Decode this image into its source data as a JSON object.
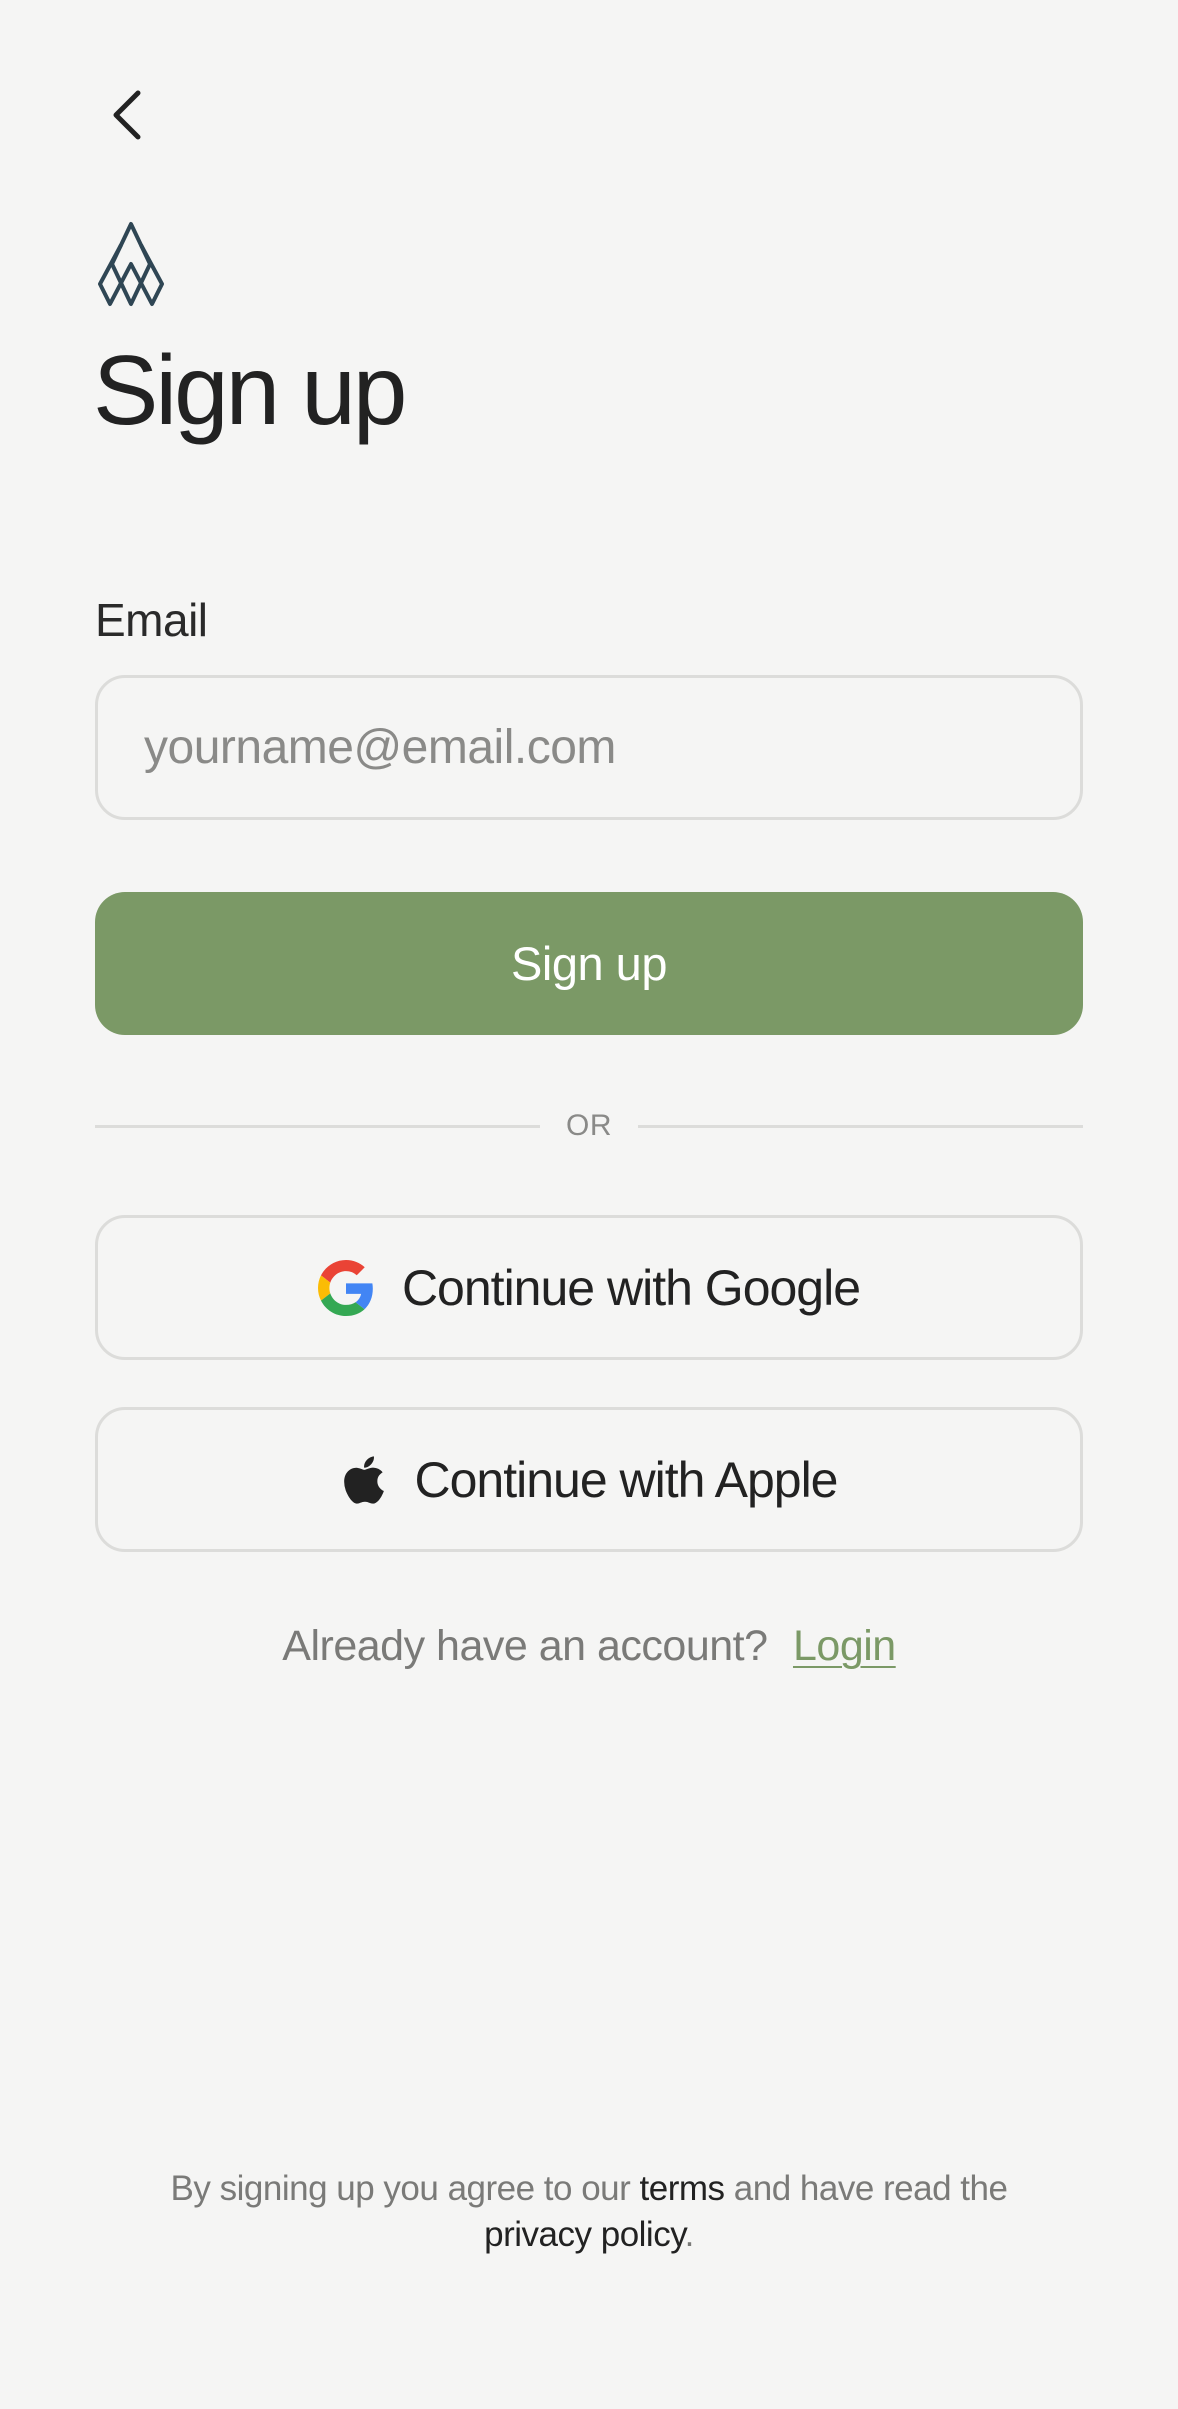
{
  "header": {
    "back_icon": "chevron-left-icon",
    "logo_icon": "diamond-logo-icon",
    "title": "Sign up"
  },
  "form": {
    "email_label": "Email",
    "email_value": "",
    "email_placeholder": "yourname@email.com",
    "submit_label": "Sign up"
  },
  "divider": {
    "text": "OR"
  },
  "oauth": {
    "google_icon": "google-icon",
    "google_label": "Continue with Google",
    "apple_icon": "apple-icon",
    "apple_label": "Continue with Apple"
  },
  "login": {
    "prompt": "Already have an account?",
    "link_label": "Login"
  },
  "legal": {
    "prefix": "By signing up you agree to our",
    "terms_label": "terms",
    "middle": "and have read the",
    "privacy_label": "privacy policy",
    "suffix": "."
  },
  "colors": {
    "background": "#f5f5f4",
    "accent": "#7b9966",
    "text": "#222222",
    "muted": "#7a7a78",
    "border": "#dcdcda"
  }
}
